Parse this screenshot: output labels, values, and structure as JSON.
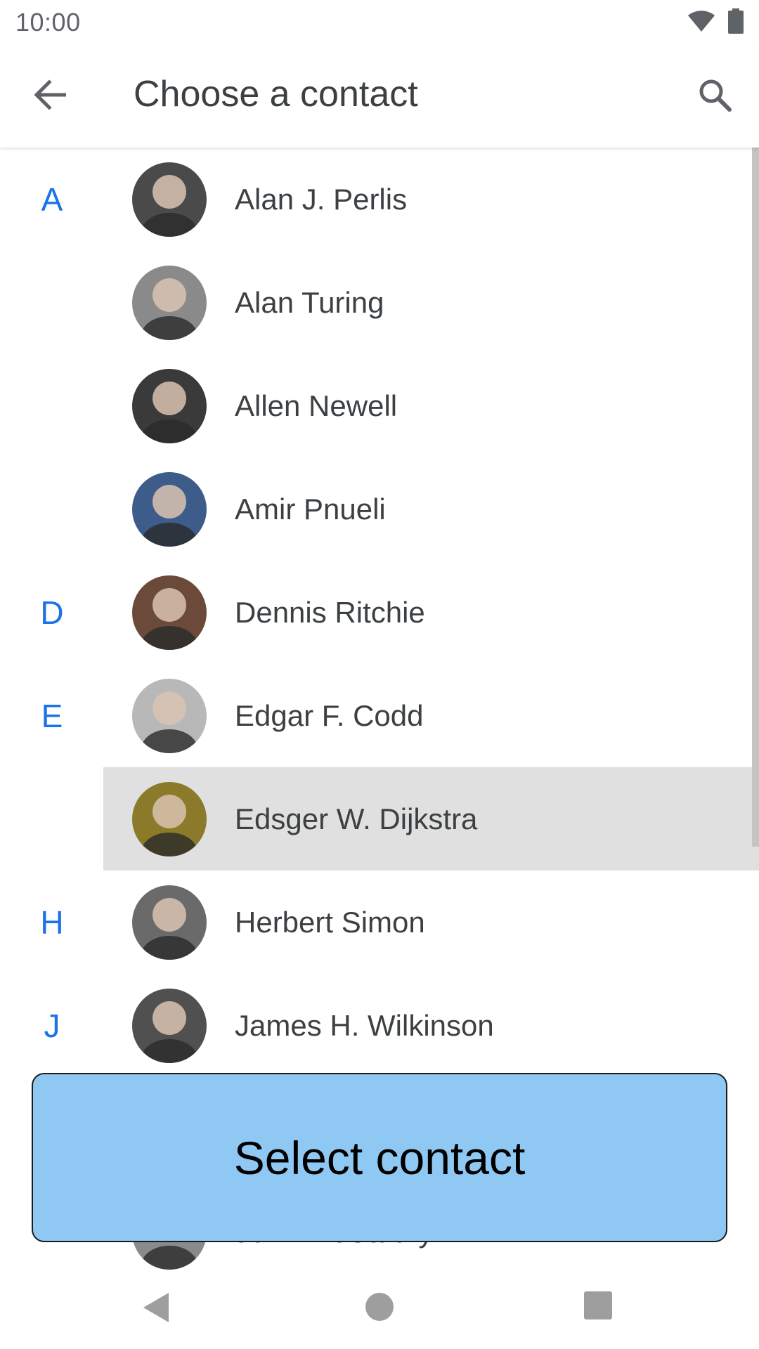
{
  "status_bar": {
    "time": "10:00",
    "icons": [
      "wifi-icon",
      "battery-icon"
    ]
  },
  "app_bar": {
    "title": "Choose a contact",
    "back_icon": "arrow-back-icon",
    "search_icon": "search-icon"
  },
  "contacts": [
    {
      "section": "A",
      "name": "Alan J. Perlis",
      "avatar_color": "#4a4a4a"
    },
    {
      "section": "",
      "name": "Alan Turing",
      "avatar_color": "#8a8a8a"
    },
    {
      "section": "",
      "name": "Allen Newell",
      "avatar_color": "#3a3a3a"
    },
    {
      "section": "",
      "name": "Amir Pnueli",
      "avatar_color": "#3d5c8a"
    },
    {
      "section": "D",
      "name": "Dennis Ritchie",
      "avatar_color": "#6b4a3a"
    },
    {
      "section": "E",
      "name": "Edgar F. Codd",
      "avatar_color": "#b8b8b8"
    },
    {
      "section": "",
      "name": "Edsger W. Dijkstra",
      "avatar_color": "#8a7a2a",
      "highlighted": true
    },
    {
      "section": "H",
      "name": "Herbert Simon",
      "avatar_color": "#6a6a6a"
    },
    {
      "section": "J",
      "name": "James H. Wilkinson",
      "avatar_color": "#505050"
    },
    {
      "section": "",
      "name": "",
      "avatar_color": "#6a6a6a"
    },
    {
      "section": "",
      "name": "John McCarthy",
      "avatar_color": "#8a8a8a"
    }
  ],
  "select_button": {
    "label": "Select contact"
  },
  "colors": {
    "accent": "#1a73e8",
    "select_button_bg": "#90c8f4",
    "highlight_row": "#e0e0e0"
  }
}
